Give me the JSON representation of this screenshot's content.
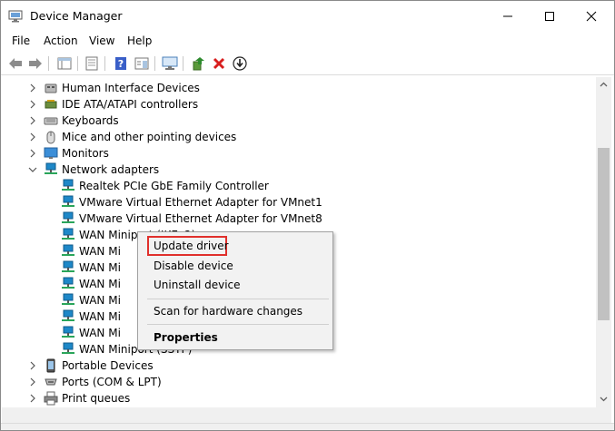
{
  "window": {
    "title": "Device Manager"
  },
  "menu": {
    "file": "File",
    "action": "Action",
    "view": "View",
    "help": "Help"
  },
  "tree": {
    "categories_top": [
      {
        "label": "Human Interface Devices",
        "icon": "hid-icon"
      },
      {
        "label": "IDE ATA/ATAPI controllers",
        "icon": "ide-controller-icon"
      },
      {
        "label": "Keyboards",
        "icon": "keyboard-icon"
      },
      {
        "label": "Mice and other pointing devices",
        "icon": "mouse-icon"
      },
      {
        "label": "Monitors",
        "icon": "monitor-icon"
      },
      {
        "label": "Network adapters",
        "icon": "network-icon",
        "expanded": true
      }
    ],
    "network_children": [
      "Realtek PCIe GbE Family Controller",
      "VMware Virtual Ethernet Adapter for VMnet1",
      "VMware Virtual Ethernet Adapter for VMnet8",
      "WAN Miniport (IKEv2)",
      "WAN Mi",
      "WAN Mi",
      "WAN Mi",
      "WAN Mi",
      "WAN Mi",
      "WAN Mi",
      "WAN Miniport (SSTP)"
    ],
    "categories_bottom": [
      {
        "label": "Portable Devices",
        "icon": "portable-device-icon"
      },
      {
        "label": "Ports (COM & LPT)",
        "icon": "port-icon"
      },
      {
        "label": "Print queues",
        "icon": "printer-icon"
      }
    ]
  },
  "context_menu": {
    "update_driver": "Update driver",
    "disable_device": "Disable device",
    "uninstall_device": "Uninstall device",
    "scan_hardware": "Scan for hardware changes",
    "properties": "Properties"
  },
  "colors": {
    "highlight_border": "#e0302c",
    "network_icon": "#1e88c8"
  }
}
